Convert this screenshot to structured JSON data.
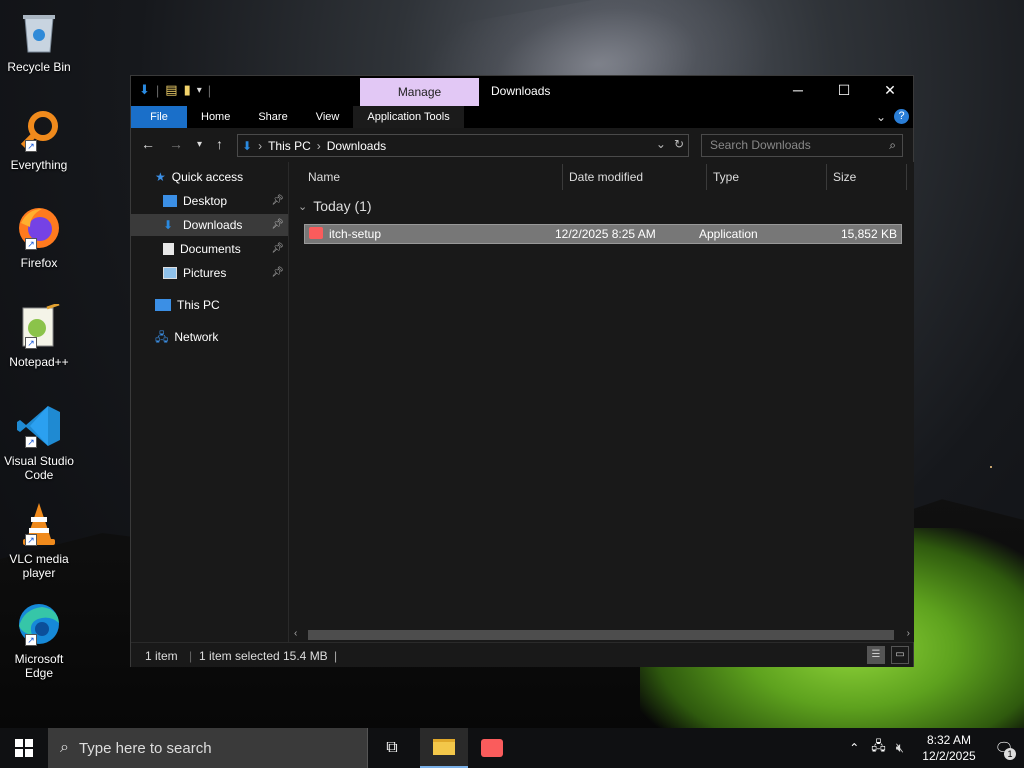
{
  "desktop": {
    "icons": [
      {
        "label": "Recycle Bin",
        "icon": "recycle-bin-icon"
      },
      {
        "label": "Everything",
        "icon": "everything-search-icon"
      },
      {
        "label": "Firefox",
        "icon": "firefox-icon"
      },
      {
        "label": "Notepad++",
        "icon": "notepad-plus-plus-icon"
      },
      {
        "label": "Visual Studio Code",
        "icon": "vscode-icon"
      },
      {
        "label": "VLC media player",
        "icon": "vlc-icon"
      },
      {
        "label": "Microsoft Edge",
        "icon": "edge-icon"
      }
    ]
  },
  "window": {
    "title": "Downloads",
    "manage_tab": "Manage",
    "ribbon_tabs": [
      "File",
      "Home",
      "Share",
      "View",
      "Application Tools"
    ],
    "address": {
      "segments": [
        "This PC",
        "Downloads"
      ]
    },
    "search_placeholder": "Search Downloads",
    "nav": {
      "quick_access": "Quick access",
      "items": [
        {
          "label": "Desktop",
          "pinned": true
        },
        {
          "label": "Downloads",
          "pinned": true,
          "selected": true
        },
        {
          "label": "Documents",
          "pinned": true
        },
        {
          "label": "Pictures",
          "pinned": true
        }
      ],
      "this_pc": "This PC",
      "network": "Network"
    },
    "columns": [
      "Name",
      "Date modified",
      "Type",
      "Size"
    ],
    "group": "Today (1)",
    "files": [
      {
        "name": "itch-setup",
        "date": "12/2/2025 8:25 AM",
        "type": "Application",
        "size": "15,852 KB"
      }
    ],
    "status": {
      "count": "1 item",
      "selected": "1 item selected",
      "size": "15.4 MB"
    }
  },
  "taskbar": {
    "search_placeholder": "Type here to search",
    "time": "8:32 AM",
    "date": "12/2/2025",
    "notification_count": "1"
  },
  "colors": {
    "accent": "#1a6fc9",
    "manage": "#e2c8f5",
    "selection": "#777777"
  }
}
